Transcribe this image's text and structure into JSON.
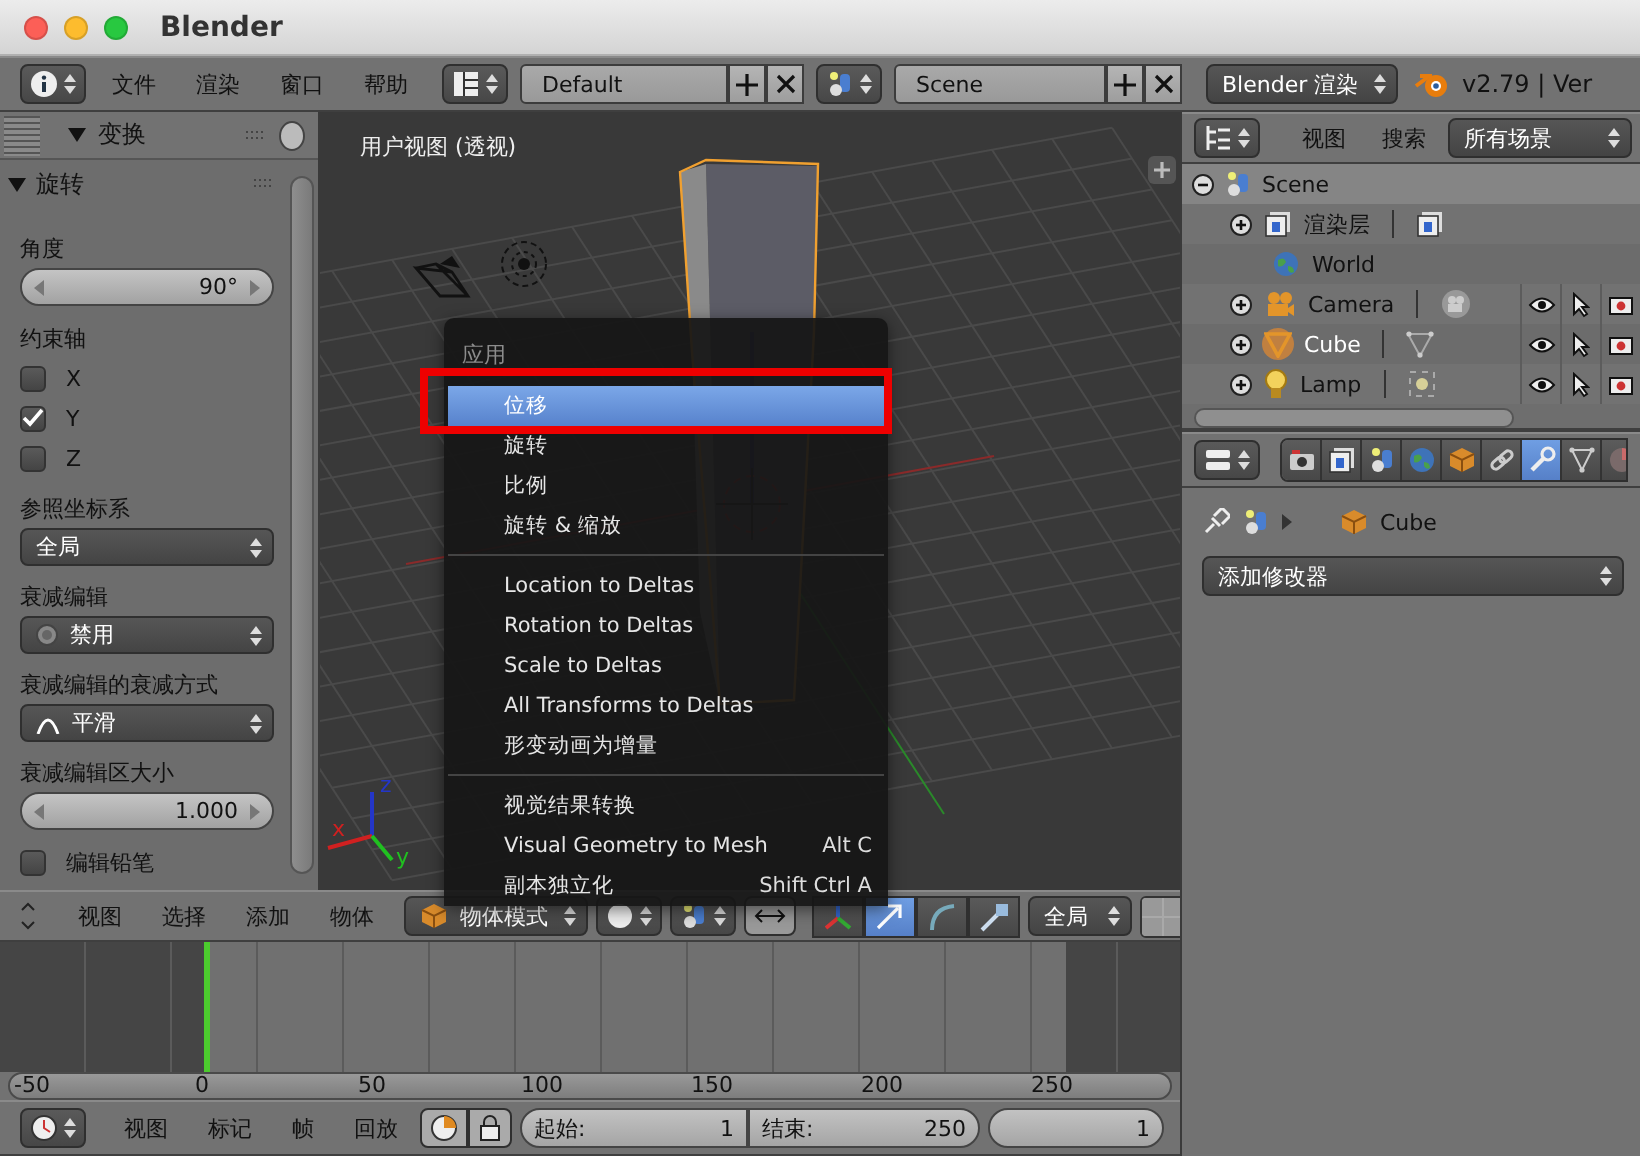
{
  "window": {
    "title": "Blender"
  },
  "top_bar": {
    "menus": [
      {
        "label": "文件"
      },
      {
        "label": "渲染"
      },
      {
        "label": "窗口"
      },
      {
        "label": "帮助"
      }
    ],
    "layout": "Default",
    "scene": "Scene",
    "engine": "Blender 渲染",
    "version": "v2.79 | Ver"
  },
  "tool_panel": {
    "title": "变换",
    "expanded": true,
    "operator": {
      "title": "旋转",
      "expanded": true,
      "controls": [
        {
          "kind": "label",
          "text": "角度"
        },
        {
          "kind": "number",
          "value": "90°"
        },
        {
          "kind": "label",
          "text": "约束轴"
        },
        {
          "kind": "checkbox",
          "text": "X",
          "checked": false
        },
        {
          "kind": "checkbox",
          "text": "Y",
          "checked": true
        },
        {
          "kind": "checkbox",
          "text": "Z",
          "checked": false
        },
        {
          "kind": "label",
          "text": "参照坐标系"
        },
        {
          "kind": "dropdown",
          "value": "全局"
        },
        {
          "kind": "label",
          "text": "衰减编辑"
        },
        {
          "kind": "radio_dropdown",
          "value": "禁用"
        },
        {
          "kind": "label",
          "text": "衰减编辑的衰减方式"
        },
        {
          "kind": "curve_dropdown",
          "value": "平滑"
        },
        {
          "kind": "label",
          "text": "衰减编辑区大小"
        },
        {
          "kind": "number",
          "value": "1.000"
        },
        {
          "kind": "checkbox",
          "text": "编辑铅笔",
          "checked": false
        }
      ]
    }
  },
  "viewport": {
    "label": "用户视图 (透视)",
    "axes": [
      "x",
      "y",
      "z"
    ]
  },
  "menu": {
    "title": "应用",
    "sections": [
      [
        {
          "label": "位移",
          "selected": true
        },
        {
          "label": "旋转",
          "selected": false
        },
        {
          "label": "比例",
          "selected": false
        },
        {
          "label": "旋转 & 缩放",
          "selected": false
        }
      ],
      [
        {
          "label": "Location to Deltas",
          "selected": false
        },
        {
          "label": "Rotation to Deltas",
          "selected": false
        },
        {
          "label": "Scale to Deltas",
          "selected": false
        },
        {
          "label": "All Transforms to Deltas",
          "selected": false
        },
        {
          "label": "形变动画为增量",
          "selected": false
        }
      ],
      [
        {
          "label": "视觉结果转换",
          "selected": false
        },
        {
          "label": "Visual Geometry to Mesh",
          "shortcut": "Alt C",
          "selected": false
        },
        {
          "label": "副本独立化",
          "shortcut": "Shift Ctrl A",
          "selected": false
        }
      ]
    ]
  },
  "view_header": {
    "menus": [
      {
        "label": "视图"
      },
      {
        "label": "选择"
      },
      {
        "label": "添加"
      },
      {
        "label": "物体"
      }
    ],
    "mode": "物体模式",
    "manipulators": [
      {
        "kind": "axes",
        "selected": false
      },
      {
        "kind": "translate",
        "selected": true
      },
      {
        "kind": "rotate",
        "selected": false
      },
      {
        "kind": "scale",
        "selected": false
      }
    ],
    "orientation": "全局"
  },
  "timeline": {
    "ruler": [
      "-50",
      "0",
      "50",
      "100",
      "150",
      "200",
      "250"
    ]
  },
  "timeline_header": {
    "menus": [
      {
        "label": "视图"
      },
      {
        "label": "标记"
      },
      {
        "label": "帧"
      },
      {
        "label": "回放"
      }
    ],
    "start_label": "起始:",
    "start": "1",
    "end_label": "结束:",
    "end": "250",
    "current": "1"
  },
  "outliner": {
    "menus": [
      {
        "label": "视图"
      },
      {
        "label": "搜索"
      }
    ],
    "filter": "所有场景",
    "tree": {
      "label": "Scene",
      "expanded": true,
      "selected": true,
      "children": [
        {
          "label": "渲染层",
          "kind": "render_layers",
          "expanded": false
        },
        {
          "label": "World",
          "kind": "world"
        },
        {
          "label": "Camera",
          "kind": "camera",
          "expanded": false,
          "active": false
        },
        {
          "label": "Cube",
          "kind": "mesh",
          "expanded": false,
          "active": true
        },
        {
          "label": "Lamp",
          "kind": "lamp",
          "expanded": false,
          "active": false
        }
      ]
    }
  },
  "properties": {
    "tabs": [
      {
        "kind": "render",
        "selected": false
      },
      {
        "kind": "render_layers",
        "selected": false
      },
      {
        "kind": "scene",
        "selected": false
      },
      {
        "kind": "world",
        "selected": false
      },
      {
        "kind": "object",
        "selected": false
      },
      {
        "kind": "constraints",
        "selected": false
      },
      {
        "kind": "modifiers",
        "selected": true
      },
      {
        "kind": "data",
        "selected": false
      },
      {
        "kind": "material",
        "selected": false
      }
    ],
    "object": "Cube",
    "modifier_menu": "添加修改器"
  }
}
